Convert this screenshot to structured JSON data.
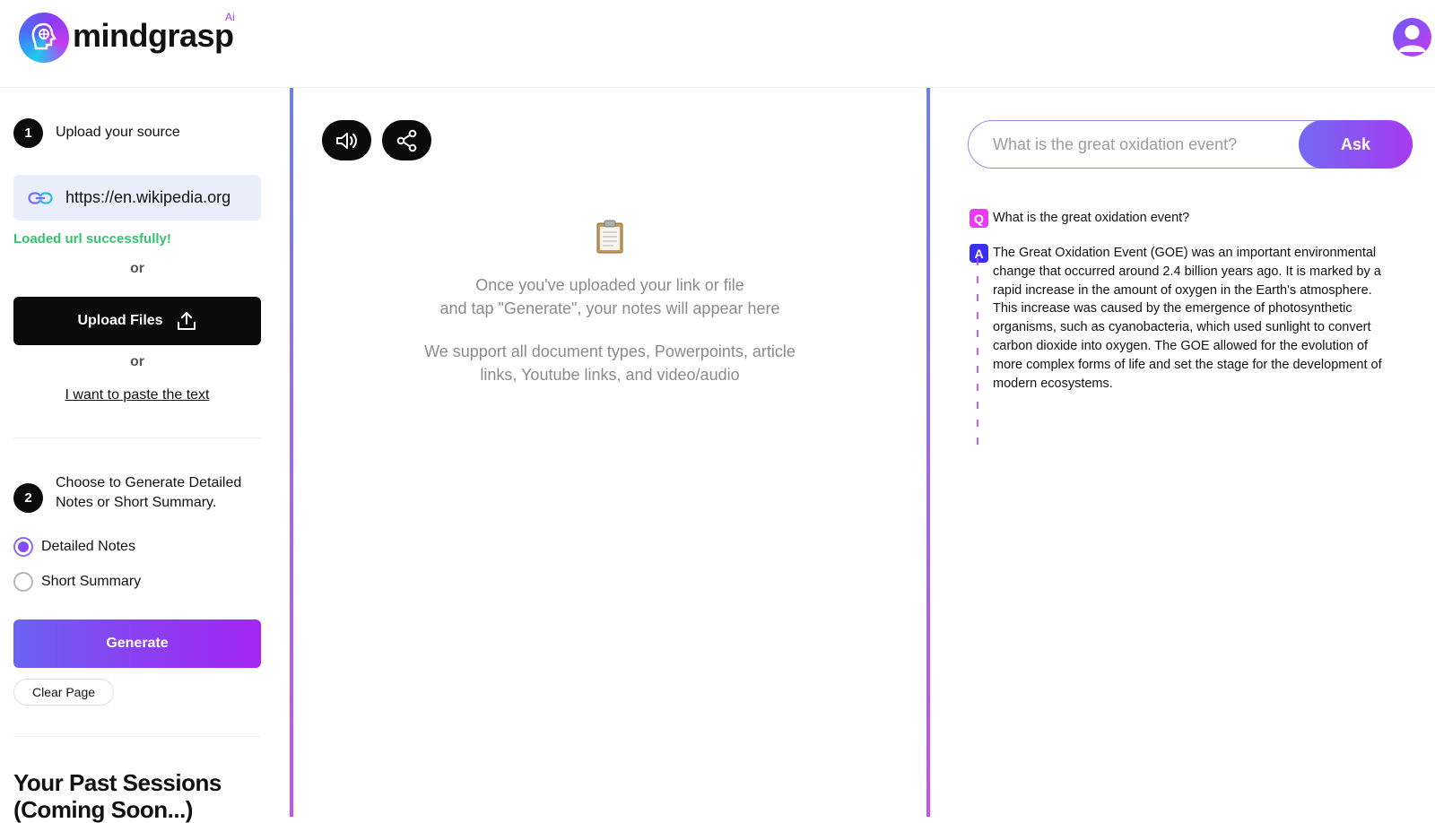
{
  "header": {
    "brand": "mindgrasp",
    "brand_suffix": "Ai"
  },
  "sidebar": {
    "step1": {
      "number": "1",
      "label": "Upload your source"
    },
    "url_value": "https://en.wikipedia.org",
    "loaded_status": "Loaded url successfully!",
    "or_label": "or",
    "upload_label": "Upload Files",
    "paste_link": "I want to paste the text",
    "step2": {
      "number": "2",
      "label": "Choose to Generate Detailed Notes or Short Summary."
    },
    "options": [
      {
        "label": "Detailed Notes",
        "checked": true
      },
      {
        "label": "Short Summary",
        "checked": false
      }
    ],
    "generate_label": "Generate",
    "clear_label": "Clear Page",
    "past_sessions_title": "Your Past Sessions (Coming Soon...)"
  },
  "notes": {
    "empty_line1": "Once you've uploaded your link or file",
    "empty_line2": "and tap \"Generate\", your notes will appear here",
    "support_line1": "We support all document types, Powerpoints, article",
    "support_line2": "links, Youtube links, and video/audio"
  },
  "chat": {
    "input_placeholder": "What is the great oxidation event?",
    "ask_label": "Ask",
    "question_badge": "Q",
    "question": "What is the great oxidation event?",
    "answer_badge": "A",
    "answer": "The Great Oxidation Event (GOE) was an important environmental change that occurred around 2.4 billion years ago. It is marked by a rapid increase in the amount of oxygen in the Earth's atmosphere. This increase was caused by the emergence of photosynthetic organisms, such as cyanobacteria, which used sunlight to convert carbon dioxide into oxygen. The GOE allowed for the evolution of more complex forms of life and set the stage for the development of modern ecosystems."
  },
  "colors": {
    "accent_purple": "#a326f0",
    "accent_blue": "#6b63f3",
    "success_green": "#35c26a",
    "question_badge": "#e93cf0",
    "answer_badge": "#3a2ff0"
  }
}
